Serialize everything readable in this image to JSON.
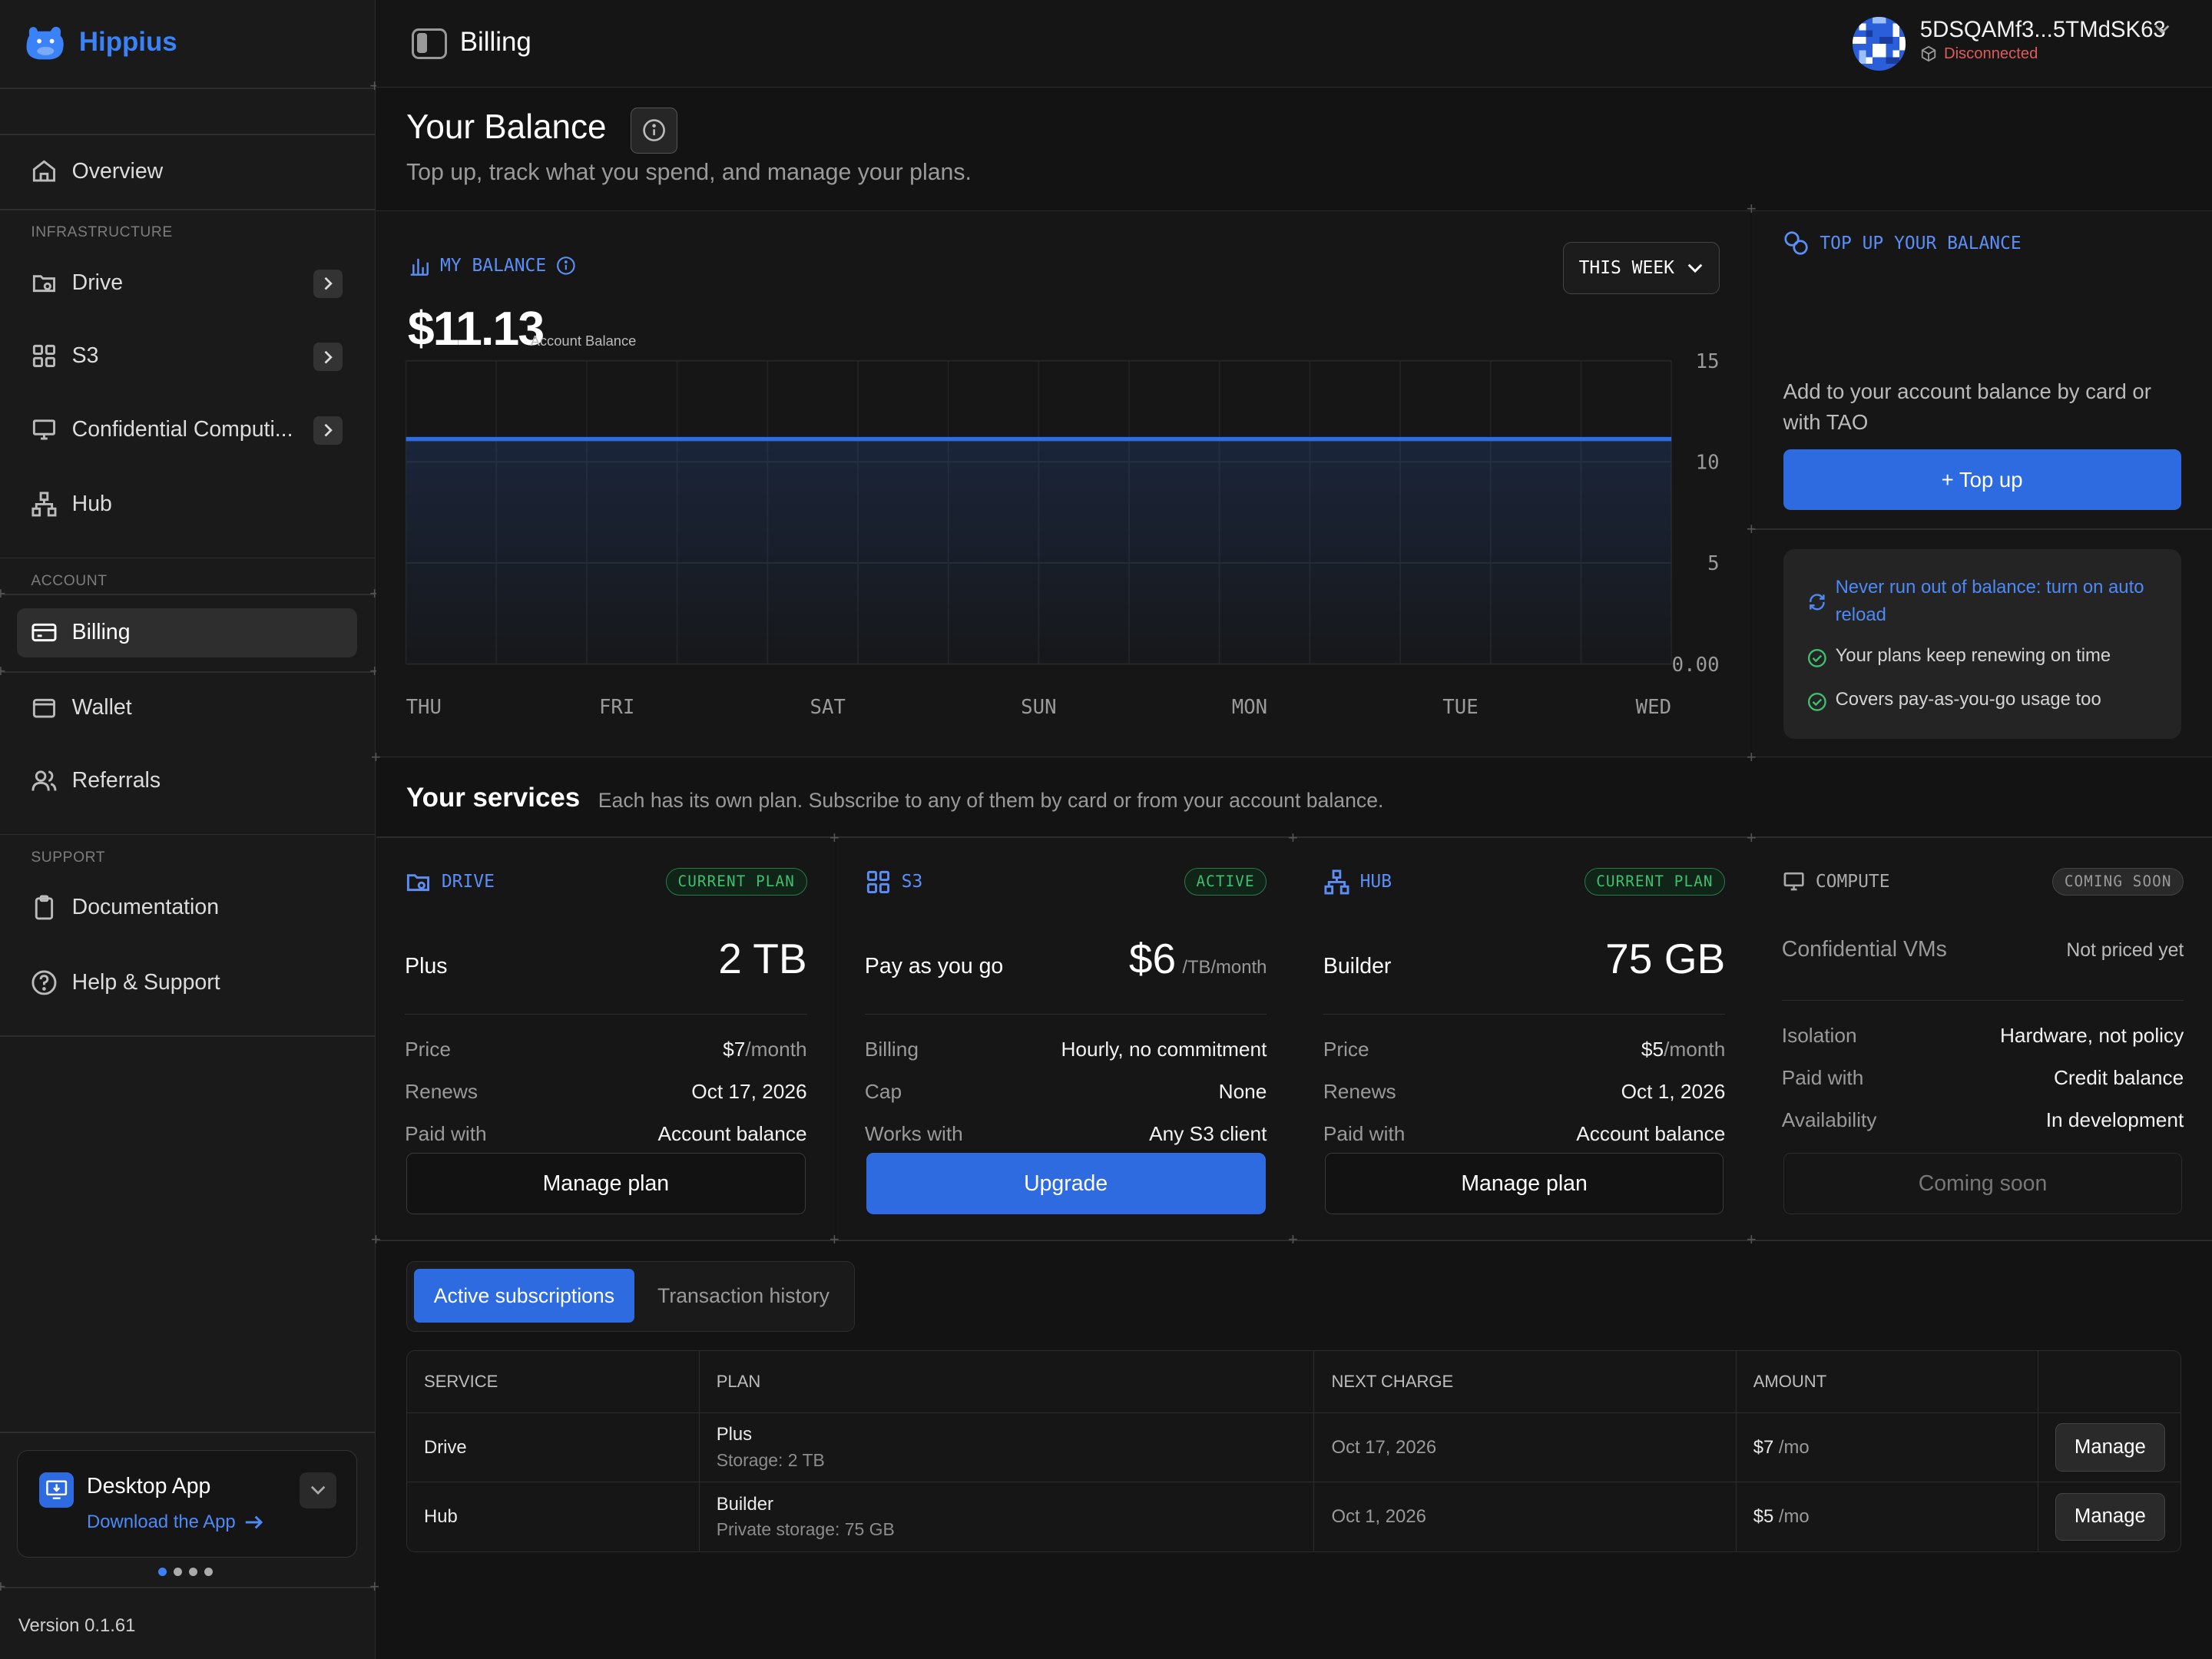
{
  "app": {
    "name": "Hippius",
    "version": "Version 0.1.61"
  },
  "colors": {
    "accent": "#2f6be0",
    "brand": "#3b82f6",
    "success": "#3fbf6f",
    "error": "#e05a5a"
  },
  "sidebar": {
    "overview": "Overview",
    "infra_label": "INFRASTRUCTURE",
    "drive": "Drive",
    "s3": "S3",
    "compute": "Confidential Computi...",
    "hub": "Hub",
    "account_label": "ACCOUNT",
    "billing": "Billing",
    "wallet": "Wallet",
    "referrals": "Referrals",
    "support_label": "SUPPORT",
    "documentation": "Documentation",
    "help": "Help & Support",
    "desktop_title": "Desktop App",
    "desktop_link": "Download the App"
  },
  "header": {
    "title": "Billing",
    "account_id": "5DSQAMf3...5TMdSK63",
    "status": "Disconnected"
  },
  "page": {
    "title": "Your Balance",
    "subtitle": "Top up, track what you spend, and manage your plans."
  },
  "balance": {
    "label": "MY BALANCE",
    "amount": "$11.13",
    "caption": "Account Balance",
    "range_select": "THIS WEEK"
  },
  "chart_data": {
    "type": "area",
    "x": [
      "THU",
      "FRI",
      "SAT",
      "SUN",
      "MON",
      "TUE",
      "WED"
    ],
    "values": [
      11.13,
      11.13,
      11.13,
      11.13,
      11.13,
      11.13,
      11.13
    ],
    "y_ticks": [
      "15",
      "10",
      "5",
      "0.00"
    ],
    "ylim": [
      0,
      15
    ],
    "grid": true,
    "color": "#2f6be0"
  },
  "topup": {
    "label": "TOP UP YOUR BALANCE",
    "desc": "Add to your account balance by card or with TAO",
    "button": "+ Top up",
    "auto_reload": "Never run out of balance: turn on auto reload",
    "point1": "Your plans keep renewing on time",
    "point2": "Covers pay-as-you-go usage too"
  },
  "services": {
    "title": "Your services",
    "subtitle": "Each has its own plan. Subscribe to any of them by card or from your account balance.",
    "items": [
      {
        "name": "DRIVE",
        "badge": "CURRENT PLAN",
        "plan": "Plus",
        "amount": "2 TB",
        "unit": "",
        "rows": [
          [
            "Price",
            "$7",
            "/month"
          ],
          [
            "Renews",
            "Oct 17, 2026",
            ""
          ],
          [
            "Paid with",
            "Account balance",
            ""
          ]
        ],
        "button": "Manage plan"
      },
      {
        "name": "S3",
        "badge": "ACTIVE",
        "plan": "Pay as you go",
        "amount": "$6",
        "unit": "/TB/month",
        "rows": [
          [
            "Billing",
            "Hourly, no commitment",
            ""
          ],
          [
            "Cap",
            "None",
            ""
          ],
          [
            "Works with",
            "Any S3 client",
            ""
          ]
        ],
        "button": "Upgrade"
      },
      {
        "name": "HUB",
        "badge": "CURRENT PLAN",
        "plan": "Builder",
        "amount": "75 GB",
        "unit": "",
        "rows": [
          [
            "Price",
            "$5",
            "/month"
          ],
          [
            "Renews",
            "Oct 1, 2026",
            ""
          ],
          [
            "Paid with",
            "Account balance",
            ""
          ]
        ],
        "button": "Manage plan"
      },
      {
        "name": "COMPUTE",
        "badge": "COMING SOON",
        "plan": "Confidential VMs",
        "amount": "Not priced yet",
        "unit": "",
        "rows": [
          [
            "Isolation",
            "Hardware, not policy",
            ""
          ],
          [
            "Paid with",
            "Credit balance",
            ""
          ],
          [
            "Availability",
            "In development",
            ""
          ]
        ],
        "button": "Coming soon"
      }
    ]
  },
  "tabs": {
    "active": "Active subscriptions",
    "history": "Transaction history"
  },
  "table": {
    "headers": [
      "SERVICE",
      "PLAN",
      "NEXT CHARGE",
      "AMOUNT"
    ],
    "rows": [
      {
        "service": "Drive",
        "plan": "Plus",
        "detail": "Storage: 2 TB",
        "next": "Oct 17, 2026",
        "amount": "$7",
        "per": "/mo",
        "action": "Manage"
      },
      {
        "service": "Hub",
        "plan": "Builder",
        "detail": "Private storage: 75 GB",
        "next": "Oct 1, 2026",
        "amount": "$5",
        "per": "/mo",
        "action": "Manage"
      }
    ]
  }
}
